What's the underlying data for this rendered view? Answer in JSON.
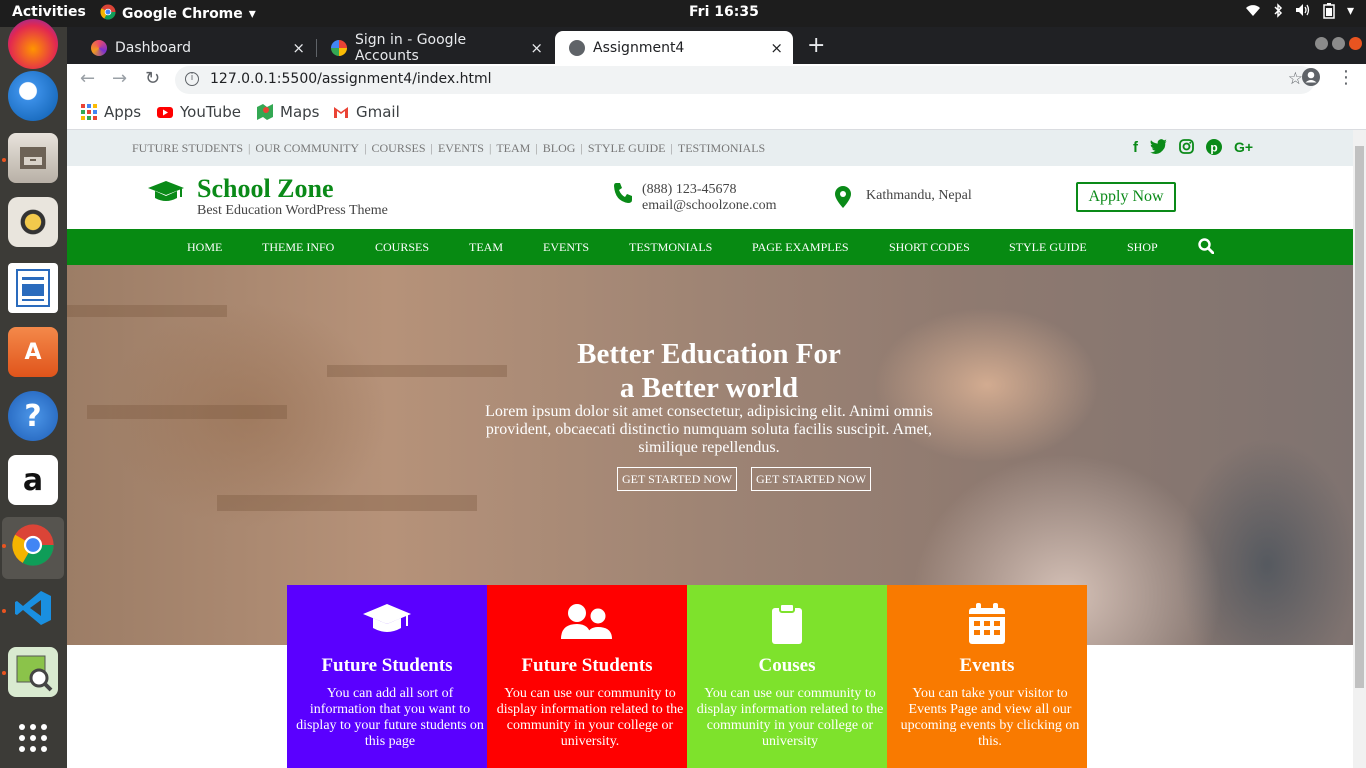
{
  "os": {
    "activities": "Activities",
    "app_name": "Google Chrome",
    "clock": "Fri 16:35",
    "tray_icons": [
      "wifi-icon",
      "bluetooth-icon",
      "volume-icon",
      "battery-icon",
      "power-menu-icon"
    ]
  },
  "dock": {
    "apps": [
      "firefox",
      "thunderbird",
      "files",
      "rhythmbox",
      "libreoffice-writer",
      "ubuntu-software",
      "help",
      "amazon",
      "chrome",
      "vscode",
      "image-viewer",
      "show-applications"
    ]
  },
  "browser": {
    "tabs": [
      {
        "label": "Dashboard",
        "close": "×"
      },
      {
        "label": "Sign in - Google Accounts",
        "close": "×"
      },
      {
        "label": "Assignment4",
        "close": "×"
      }
    ],
    "new_tab": "+",
    "url": "127.0.0.1:5500/assignment4/index.html",
    "bookmarks": [
      "Apps",
      "YouTube",
      "Maps",
      "Gmail"
    ]
  },
  "site": {
    "top_links": [
      "FUTURE STUDENTS",
      "OUR COMMUNITY",
      "COURSES",
      "EVENTS",
      "TEAM",
      "BLOG",
      "STYLE GUIDE",
      "TESTIMONIALS"
    ],
    "social": [
      "f",
      "t",
      "ig",
      "p",
      "G+"
    ],
    "brand": "School Zone",
    "tagline": "Best Education WordPress Theme",
    "phone": "(888) 123-45678",
    "email": "email@schoolzone.com",
    "location": "Kathmandu, Nepal",
    "apply_button": "Apply Now",
    "nav": [
      "HOME",
      "THEME INFO",
      "COURSES",
      "TEAM",
      "EVENTS",
      "TESTMONIALS",
      "PAGE EXAMPLES",
      "SHORT CODES",
      "STYLE GUIDE",
      "SHOP"
    ],
    "hero": {
      "title_line1": "Better Education For",
      "title_line2": "a Better world",
      "text": "Lorem ipsum dolor sit amet consectetur, adipisicing elit. Animi omnis provident, obcaecati distinctio numquam soluta facilis suscipit. Amet, similique repellendus.",
      "button1": "GET STARTED NOW",
      "button2": "GET STARTED NOW"
    },
    "cards": [
      {
        "title": "Future Students",
        "text": "You can add all sort of information that you want to display to your future students on this page",
        "color": "#5a00ff"
      },
      {
        "title": "Future Students",
        "text": "You can use our community to display information related to the community in your college or university.",
        "color": "#ff0000"
      },
      {
        "title": "Couses",
        "text": "You can use our community to display information related to the community in your college or university",
        "color": "#7ee22c"
      },
      {
        "title": "Events",
        "text": "You can take your visitor to Events Page and view all our upcoming events by clicking on this.",
        "color": "#f97a00"
      }
    ],
    "colors": {
      "brand_green": "#078a12",
      "topbar_bg": "#e8eef0"
    }
  }
}
